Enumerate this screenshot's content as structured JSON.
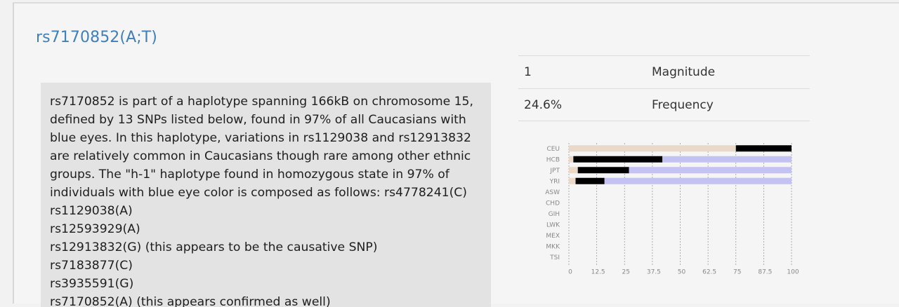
{
  "snp": {
    "title": "rs7170852(A;T)"
  },
  "description": {
    "lines": [
      "rs7170852 is part of a haplotype spanning 166kB on chromosome 15, defined by 13 SNPs listed below, found in 97% of all Caucasians with blue eyes. In this haplotype, variations in rs1129038 and rs12913832 are relatively common in Caucasians though rare among other ethnic groups. The \"h-1\" haplotype found in homozygous state in 97% of individuals with blue eye color is composed as follows: rs4778241(C)",
      "rs1129038(A)",
      "rs12593929(A)",
      "rs12913832(G) (this appears to be the causative SNP)",
      "rs7183877(C)",
      "rs3935591(G)",
      "rs7170852(A) (this appears confirmed as well)"
    ]
  },
  "stats": {
    "magnitude_value": "1",
    "magnitude_label": "Magnitude",
    "frequency_value": "24.6%",
    "frequency_label": "Frequency"
  },
  "chart_data": {
    "type": "bar",
    "stacked": true,
    "orientation": "horizontal",
    "categories": [
      "CEU",
      "HCB",
      "JPT",
      "YRI",
      "ASW",
      "CHD",
      "GIH",
      "LWK",
      "MEX",
      "MKK",
      "TSI"
    ],
    "series": [
      {
        "values": [
          75,
          2,
          4,
          3,
          null,
          null,
          null,
          null,
          null,
          null,
          null
        ]
      },
      {
        "values": [
          25,
          40,
          23,
          13,
          null,
          null,
          null,
          null,
          null,
          null,
          null
        ]
      },
      {
        "values": [
          0,
          58,
          73,
          84,
          null,
          null,
          null,
          null,
          null,
          null,
          null
        ]
      }
    ],
    "xticks": [
      "0",
      "12.5",
      "25",
      "37.5",
      "50",
      "62.5",
      "75",
      "87.5",
      "100"
    ],
    "xlim": [
      0,
      100
    ],
    "grid": true,
    "colors": [
      "#ead9c8",
      "#000000",
      "#c4c2f2"
    ]
  }
}
